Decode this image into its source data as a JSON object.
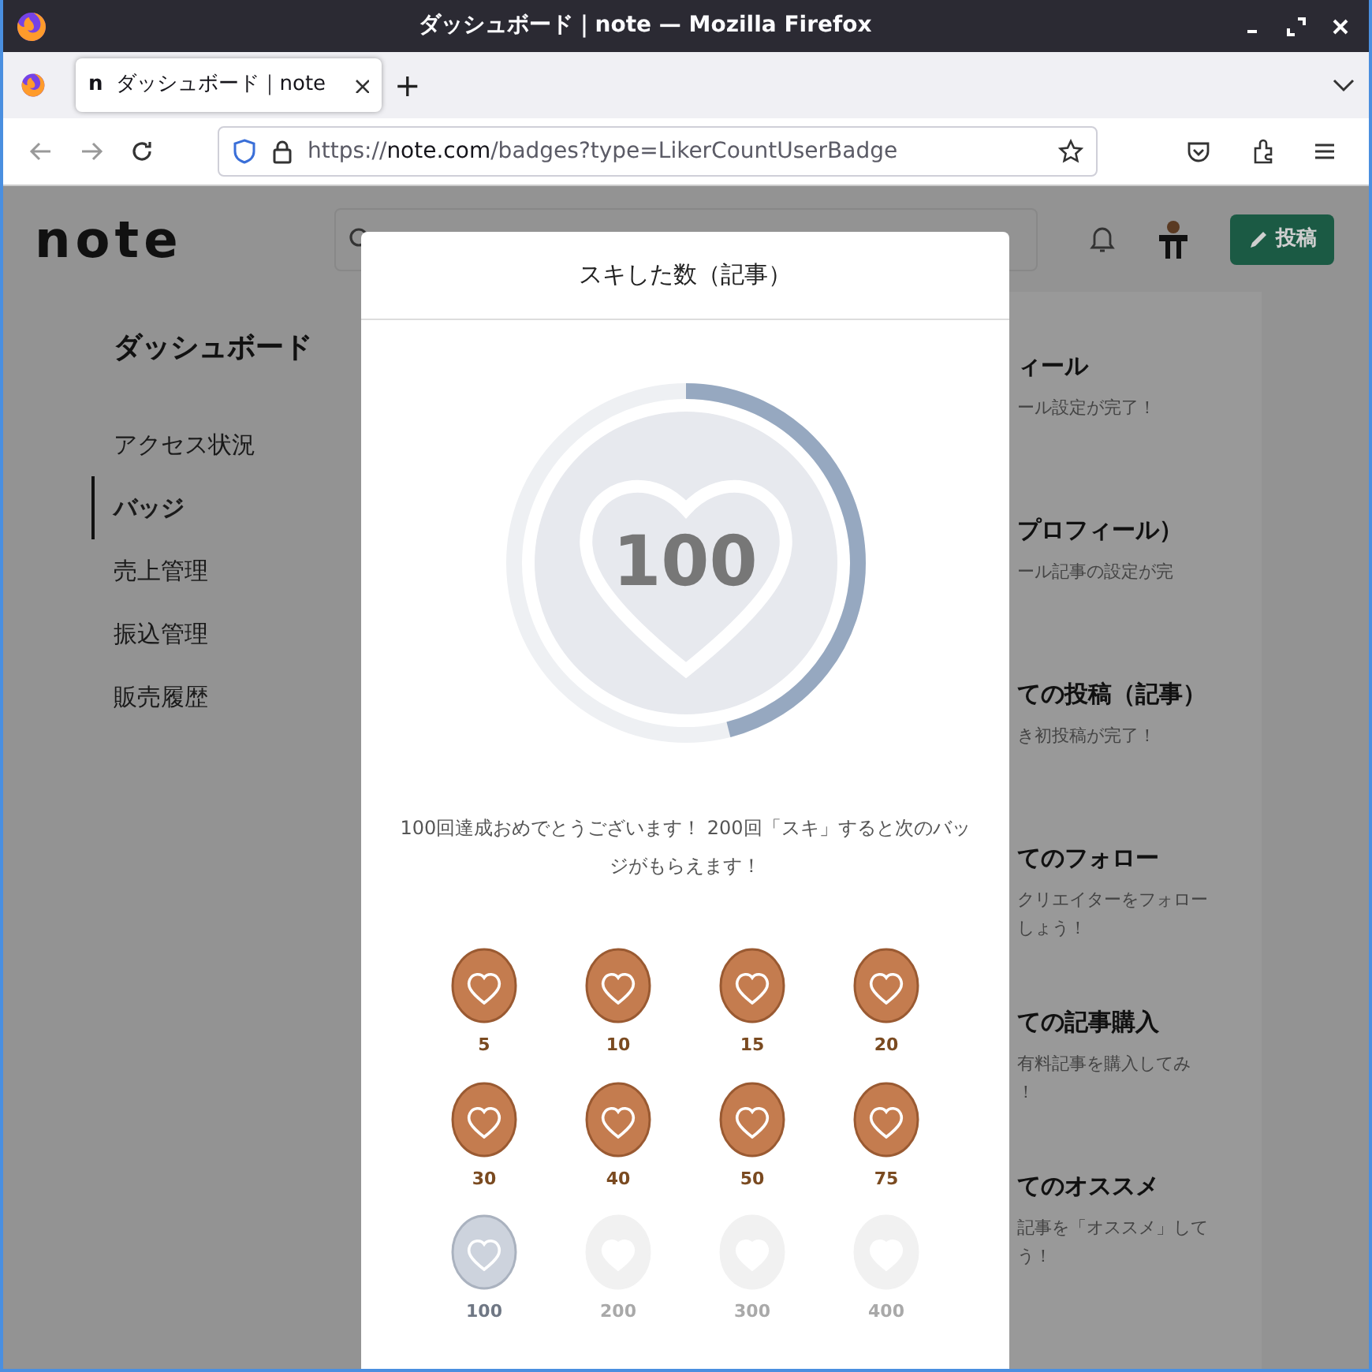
{
  "window": {
    "title": "ダッシュボード｜note — Mozilla Firefox"
  },
  "tabs": [
    {
      "favicon": "n",
      "label": "ダッシュボード｜note",
      "selected": true
    }
  ],
  "new_tab": "+",
  "address_bar": {
    "scheme": "https://",
    "host": "note.com",
    "path": "/badges?type=LikerCountUserBadge"
  },
  "site_header": {
    "logo": "note",
    "post_button": "投稿"
  },
  "sidebar": {
    "title": "ダッシュボード",
    "items": [
      {
        "label": "アクセス状況",
        "selected": false
      },
      {
        "label": "バッジ",
        "selected": true
      },
      {
        "label": "売上管理",
        "selected": false
      },
      {
        "label": "振込管理",
        "selected": false
      },
      {
        "label": "販売履歴",
        "selected": false
      }
    ]
  },
  "badge_list": [
    {
      "title": "ィール",
      "lines": [
        "ール設定が完了！"
      ]
    },
    {
      "title": "プロフィール）",
      "lines": [
        "ール記事の設定が完"
      ]
    },
    {
      "title": "ての投稿（記事）",
      "lines": [
        "き初投稿が完了！"
      ]
    },
    {
      "title": "てのフォロー",
      "lines": [
        "クリエイターをフォロー",
        "しょう！"
      ]
    },
    {
      "title": "ての記事購入",
      "lines": [
        "有料記事を購入してみ",
        "！"
      ]
    },
    {
      "title": "てのオススメ",
      "lines": [
        "記事を「オススメ」して",
        "う！"
      ]
    }
  ],
  "modal": {
    "title": "スキした数（記事）",
    "progress": {
      "level": 0.46,
      "count": "100"
    },
    "message": "100回達成おめでとうございます！ 200回「スキ」すると次のバッジがもらえます！",
    "badges": [
      {
        "kind": "bronze",
        "label": "5"
      },
      {
        "kind": "bronze",
        "label": "10"
      },
      {
        "kind": "bronze",
        "label": "15"
      },
      {
        "kind": "bronze",
        "label": "20"
      },
      {
        "kind": "bronze",
        "label": "30"
      },
      {
        "kind": "bronze",
        "label": "40"
      },
      {
        "kind": "bronze",
        "label": "50"
      },
      {
        "kind": "bronze",
        "label": "75"
      },
      {
        "kind": "silver",
        "label": "100"
      },
      {
        "kind": "locked",
        "label": "200"
      },
      {
        "kind": "locked",
        "label": "300"
      },
      {
        "kind": "locked",
        "label": "400"
      }
    ]
  }
}
